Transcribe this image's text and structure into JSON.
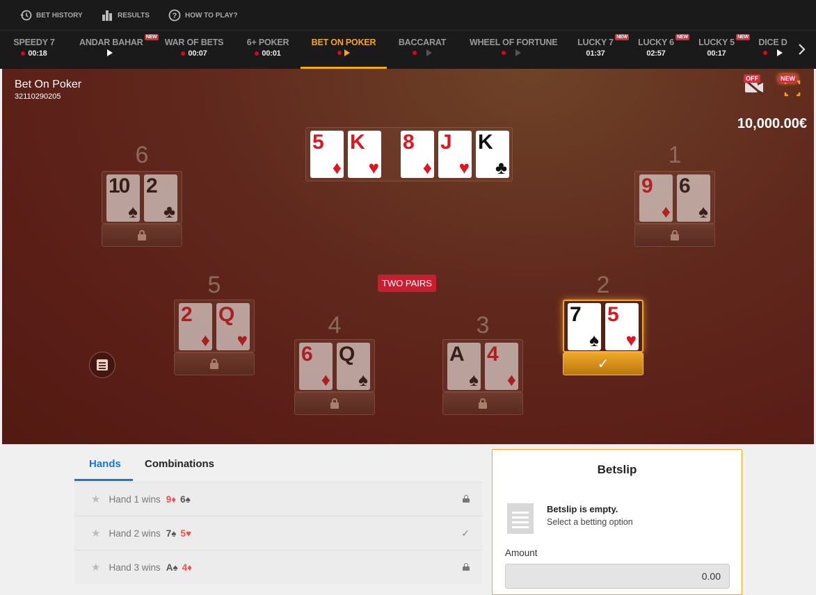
{
  "topbar": {
    "bet_history": "BET HISTORY",
    "results": "RESULTS",
    "how_to_play": "HOW TO PLAY?"
  },
  "games": [
    {
      "name": "SPEEDY 7",
      "sub": "00:18",
      "state": "timer"
    },
    {
      "name": "ANDAR BAHAR",
      "sub": "",
      "state": "play",
      "badge": "NEW"
    },
    {
      "name": "WAR OF BETS",
      "sub": "00:07",
      "state": "timer"
    },
    {
      "name": "6+ POKER",
      "sub": "00:01",
      "state": "timer"
    },
    {
      "name": "BET ON POKER",
      "sub": "",
      "state": "active"
    },
    {
      "name": "BACCARAT",
      "sub": "",
      "state": "live-grey"
    },
    {
      "name": "WHEEL OF FORTUNE",
      "sub": "",
      "state": "live-grey"
    },
    {
      "name": "LUCKY 7",
      "sub": "01:37",
      "state": "timer-nodot",
      "badge": "NEW"
    },
    {
      "name": "LUCKY 6",
      "sub": "02:57",
      "state": "timer-nodot",
      "badge": "NEW"
    },
    {
      "name": "LUCKY 5",
      "sub": "00:17",
      "state": "timer-nodot",
      "badge": "NEW"
    },
    {
      "name": "DICE D",
      "sub": "",
      "state": "play"
    }
  ],
  "table": {
    "title": "Bet On Poker",
    "round_id": "32110290205",
    "balance": "10,000.00€",
    "cam_badge": "OFF",
    "fullscreen_badge": "NEW",
    "combination": "TWO PAIRS",
    "board": [
      {
        "rank": "5",
        "suit": "♦",
        "color": "red"
      },
      {
        "rank": "K",
        "suit": "♥",
        "color": "red"
      },
      {
        "rank": "8",
        "suit": "♦",
        "color": "red"
      },
      {
        "rank": "J",
        "suit": "♥",
        "color": "red"
      },
      {
        "rank": "K",
        "suit": "♣",
        "color": "black"
      }
    ],
    "hands": [
      {
        "number": "6",
        "cards": [
          {
            "rank": "10",
            "suit": "♠",
            "color": "black"
          },
          {
            "rank": "2",
            "suit": "♣",
            "color": "black"
          }
        ]
      },
      {
        "number": "1",
        "cards": [
          {
            "rank": "9",
            "suit": "♦",
            "color": "red"
          },
          {
            "rank": "6",
            "suit": "♠",
            "color": "black"
          }
        ]
      },
      {
        "number": "5",
        "cards": [
          {
            "rank": "2",
            "suit": "♦",
            "color": "red"
          },
          {
            "rank": "Q",
            "suit": "♥",
            "color": "red"
          }
        ]
      },
      {
        "number": "4",
        "cards": [
          {
            "rank": "6",
            "suit": "♦",
            "color": "red"
          },
          {
            "rank": "Q",
            "suit": "♠",
            "color": "black"
          }
        ]
      },
      {
        "number": "3",
        "cards": [
          {
            "rank": "A",
            "suit": "♠",
            "color": "black"
          },
          {
            "rank": "4",
            "suit": "♦",
            "color": "red"
          }
        ]
      },
      {
        "number": "2",
        "cards": [
          {
            "rank": "7",
            "suit": "♠",
            "color": "black"
          },
          {
            "rank": "5",
            "suit": "♥",
            "color": "red"
          }
        ],
        "winner": true
      }
    ]
  },
  "tabs": {
    "hands": "Hands",
    "combinations": "Combinations"
  },
  "rows": [
    {
      "label": "Hand 1 wins",
      "c1": "9♦",
      "c1color": "red",
      "c2": "6♠",
      "c2color": "black",
      "status": "lock"
    },
    {
      "label": "Hand 2 wins",
      "c1": "7♠",
      "c1color": "black",
      "c2": "5♥",
      "c2color": "red",
      "status": "check"
    },
    {
      "label": "Hand 3 wins",
      "c1": "A♠",
      "c1color": "black",
      "c2": "4♦",
      "c2color": "red",
      "status": "lock"
    }
  ],
  "betslip": {
    "title": "Betslip",
    "empty_title": "Betslip is empty.",
    "empty_sub": "Select a betting option",
    "amount_label": "Amount",
    "amount_value": "0.00"
  },
  "colors": {
    "accent": "#f5a623",
    "tab_active": "#1976d2",
    "combo_badge": "#c81e32"
  }
}
